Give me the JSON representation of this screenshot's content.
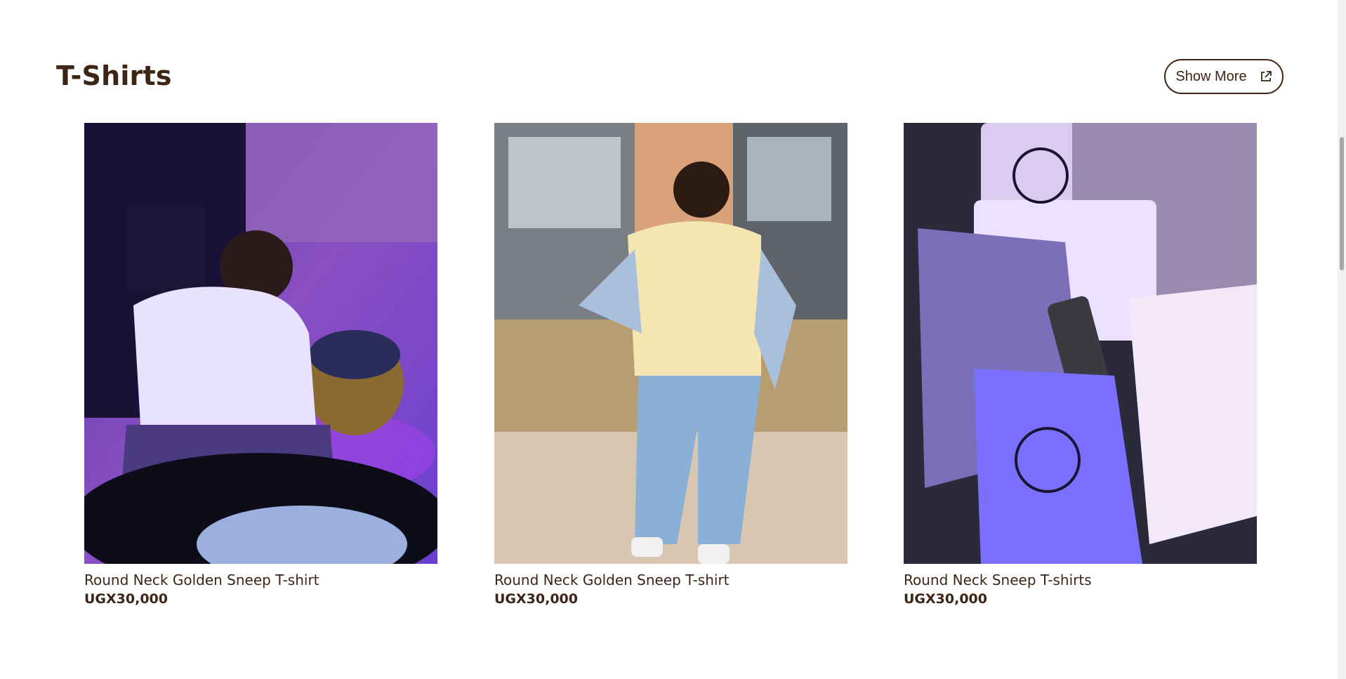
{
  "section": {
    "title": "T-Shirts",
    "show_more_label": "Show More",
    "show_more_icon": "external-link-icon"
  },
  "products": [
    {
      "name": "Round Neck Golden Sneep T-shirt",
      "price": "UGX30,000"
    },
    {
      "name": "Round Neck Golden Sneep T-shirt",
      "price": "UGX30,000"
    },
    {
      "name": "Round Neck Sneep T-shirts",
      "price": "UGX30,000"
    }
  ],
  "colors": {
    "text": "#3d2417",
    "background": "#ffffff"
  }
}
